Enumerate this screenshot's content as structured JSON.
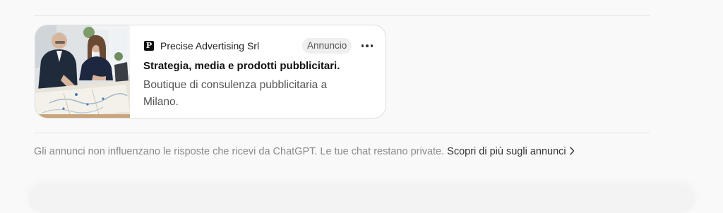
{
  "ad": {
    "advertiser": "Precise Advertising Srl",
    "logo_letter": "P",
    "badge": "Annuncio",
    "headline": "Strategia, media e prodotti pubblicitari.",
    "description": "Boutique di consulenza pubblicitaria a Milano.",
    "more_icon": "more-horizontal-icon"
  },
  "footer": {
    "disclaimer": "Gli annunci non influenzano le risposte che ricevi da ChatGPT. Le tue chat restano private.",
    "learn_more": "Scopri di più sugli annunci",
    "learn_more_icon": "chevron-right-icon"
  }
}
